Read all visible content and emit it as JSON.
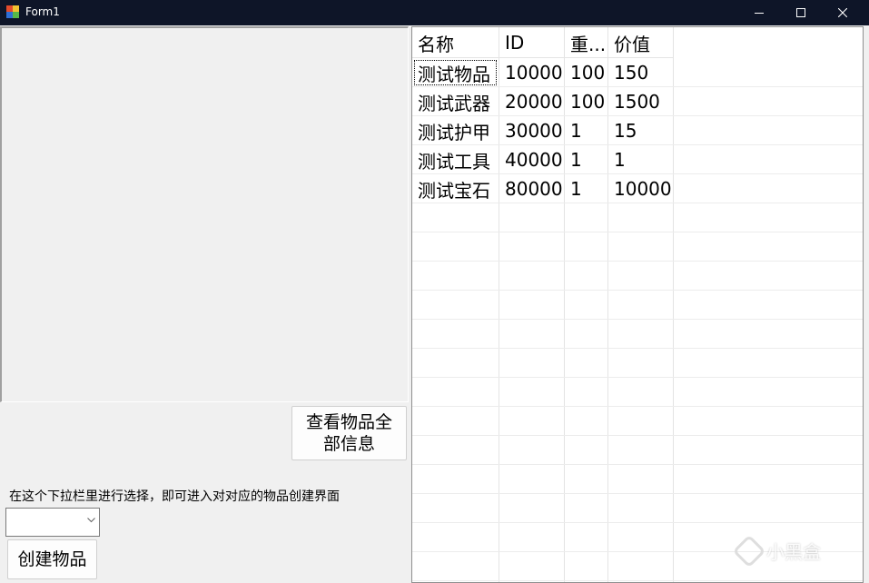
{
  "window": {
    "title": "Form1",
    "controls": [
      "minimize",
      "maximize",
      "close"
    ]
  },
  "left_panel": {
    "view_button_label": "查看物品全部信息",
    "hint_label": "在这个下拉栏里进行选择，即可进入对对应的物品创建界面",
    "combo_value": "",
    "create_button_label": "创建物品"
  },
  "grid": {
    "columns": [
      "名称",
      "ID",
      "重...",
      "价值"
    ],
    "rows": [
      [
        "测试物品",
        "10000",
        "100",
        "150"
      ],
      [
        "测试武器",
        "20000",
        "100",
        "1500"
      ],
      [
        "测试护甲",
        "30000",
        "1",
        "15"
      ],
      [
        "测试工具",
        "40000",
        "1",
        "1"
      ],
      [
        "测试宝石",
        "80000",
        "1",
        "10000"
      ]
    ]
  },
  "watermark": {
    "text": "小黑盒"
  },
  "colors": {
    "titlebar": "#0e1528",
    "window_bg": "#f0f0f0",
    "grid_bg": "#ffffff",
    "grid_line": "#e4e4e4"
  }
}
